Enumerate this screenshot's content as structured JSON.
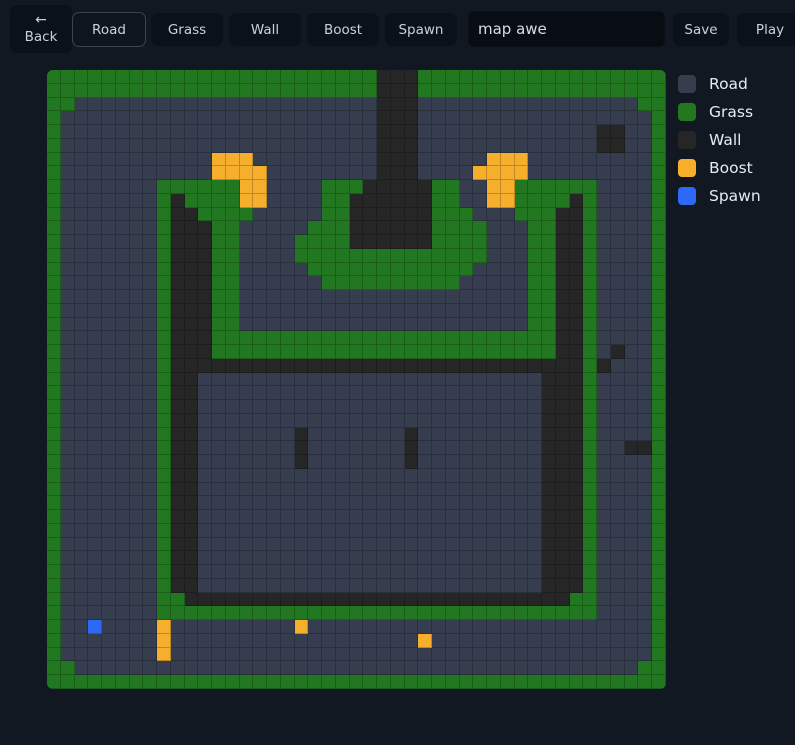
{
  "toolbar": {
    "back_arrow": "←",
    "back_label": "Back",
    "tools": [
      "Road",
      "Grass",
      "Wall",
      "Boost",
      "Spawn"
    ],
    "active_tool": "Road",
    "map_name_value": "map awe",
    "save_label": "Save",
    "play_label": "Play"
  },
  "legend": [
    {
      "label": "Road",
      "color": "#363d4f"
    },
    {
      "label": "Grass",
      "color": "#217821"
    },
    {
      "label": "Wall",
      "color": "#262626"
    },
    {
      "label": "Boost",
      "color": "#f6ae2d"
    },
    {
      "label": "Spawn",
      "color": "#2d68f6"
    }
  ],
  "map": {
    "size": 45,
    "legend_chars": {
      "R": "Road",
      "G": "Grass",
      "W": "Wall",
      "B": "Boost",
      "S": "Spawn"
    },
    "rows": [
      "GGGGGGGGGGGGGGGGGGGGGGGGWWWGGGGGGGGGGGGGGGGGG",
      "GGGGGGGGGGGGGGGGGGGGGGGGWWWGGGGGGGGGGGGGGGGGG",
      "GGRRRRRRRRRRRRRRRRRRRRRRWWWRRRRRRRRRRRRRRRRGG",
      "GRRRRRRRRRRRRRRRRRRRRRRRWWWRRRRRRRRRRRRRRRRRG",
      "GRRRRRRRRRRRRRRRRRRRRRRRWWWRRRRRRRRRRRRRWWRRG",
      "GRRRRRRRRRRRRRRRRRRRRRRRWWWRRRRRRRRRRRRRWWRRG",
      "GRRRRRRRRRRRBBBRRRRRRRRRWWWRRRRRBBBRRRRRRRRRG",
      "GRRRRRRRRRRRBBBBRRRRRRRRWWWRRRRBBBBRRRRRRRRRG",
      "GRRRRRRRGGGGGGBBRRRRGGGWWWWWGGRRBBGGGGGGRRRRG",
      "GRRRRRRRGWGGGGBBRRRRGGWWWWWWGGRRBBGGGGWGRRRRG",
      "GRRRRRRRGWWGGGGRRRRRGGWWWWWWGGGRRRGGGWWGRRRRG",
      "GRRRRRRRGWWWGGRRRRRGGGWWWWWWGGGGRRRGGWWGRRRRG",
      "GRRRRRRRGWWWGGRRRRGGGGWWWWWWGGGGRRRGGWWGRRRRG",
      "GRRRRRRRGWWWGGRRRRGGGGGGGGGGGGGGRRRGGWWGRRRRG",
      "GRRRRRRRGWWWGGRRRRRGGGGGGGGGGGGRRRRGGWWGRRRRG",
      "GRRRRRRRGWWWGGRRRRRRGGGGGGGGGGRRRRRGGWWGRRRRG",
      "GRRRRRRRGWWWGGRRRRRRRRRRRRRRRRRRRRRGGWWGRRRRG",
      "GRRRRRRRGWWWGGRRRRRRRRRRRRRRRRRRRRRGGWWGRRRRG",
      "GRRRRRRRGWWWGGRRRRRRRRRRRRRRRRRRRRRGGWWGRRRRG",
      "GRRRRRRRGWWWGGGGGGGGGGGGGGGGGGGGGGGGGWWGRRRRG",
      "GRRRRRRRGWWWGGGGGGGGGGGGGGGGGGGGGGGGGWWGRWRRG",
      "GRRRRRRRGWWWWWWWWWWWWWWWWWWWWWWWWWWWWWWGWRRRG",
      "GRRRRRRRGWWRRRRRRRRRRRRRRRRRRRRRRRRRWWWGRRRRG",
      "GRRRRRRRGWWRRRRRRRRRRRRRRRRRRRRRRRRRWWWGRRRRG",
      "GRRRRRRRGWWRRRRRRRRRRRRRRRRRRRRRRRRRWWWGRRRRG",
      "GRRRRRRRGWWRRRRRRRRRRRRRRRRRRRRRRRRRWWWGRRRRG",
      "GRRRRRRRGWWRRRRRRRWRRRRRRRWRRRRRRRRRWWWGRRRRG",
      "GRRRRRRRGWWRRRRRRRWRRRRRRRWRRRRRRRRRWWWGRRWWG",
      "GRRRRRRRGWWRRRRRRRWRRRRRRRWRRRRRRRRRWWWGRRRRG",
      "GRRRRRRRGWWRRRRRRRRRRRRRRRRRRRRRRRRRWWWGRRRRG",
      "GRRRRRRRGWWRRRRRRRRRRRRRRRRRRRRRRRRRWWWGRRRRG",
      "GRRRRRRRGWWRRRRRRRRRRRRRRRRRRRRRRRRRWWWGRRRRG",
      "GRRRRRRRGWWRRRRRRRRRRRRRRRRRRRRRRRRRWWWGRRRRG",
      "GRRRRRRRGWWRRRRRRRRRRRRRRRRRRRRRRRRRWWWGRRRRG",
      "GRRRRRRRGWWRRRRRRRRRRRRRRRRRRRRRRRRRWWWGRRRRG",
      "GRRRRRRRGWWRRRRRRRRRRRRRRRRRRRRRRRRRWWWGRRRRG",
      "GRRRRRRRGWWRRRRRRRRRRRRRRRRRRRRRRRRRWWWGRRRRG",
      "GRRRRRRRGWWRRRRRRRRRRRRRRRRRRRRRRRRRWWWGRRRRG",
      "GRRRRRRRGGWWWWWWWWWWWWWWWWWWWWWWWWWWWWGGRRRRG",
      "GRRRRRRRGGGGGGGGGGGGGGGGGGGGGGGGGGGGGGGGRRRRG",
      "GRRSRRRRBRRRRRRRRRBRRRRRRRRRRRRRRRRRRRRRRRRRG",
      "GRRRRRRRBRRRRRRRRRRRRRRRRRRBRRRRRRRRRRRRRRRRG",
      "GRRRRRRRBRRRRRRRRRRRRRRRRRRRRRRRRRRRRRRRRRRRG",
      "GGRRRRRRRRRRRRRRRRRRRRRRRRRRRRRRRRRRRRRRRRRGG",
      "GGGGGGGGGGGGGGGGGGGGGGGGGGGGGGGGGGGGGGGGGGGGG"
    ]
  }
}
